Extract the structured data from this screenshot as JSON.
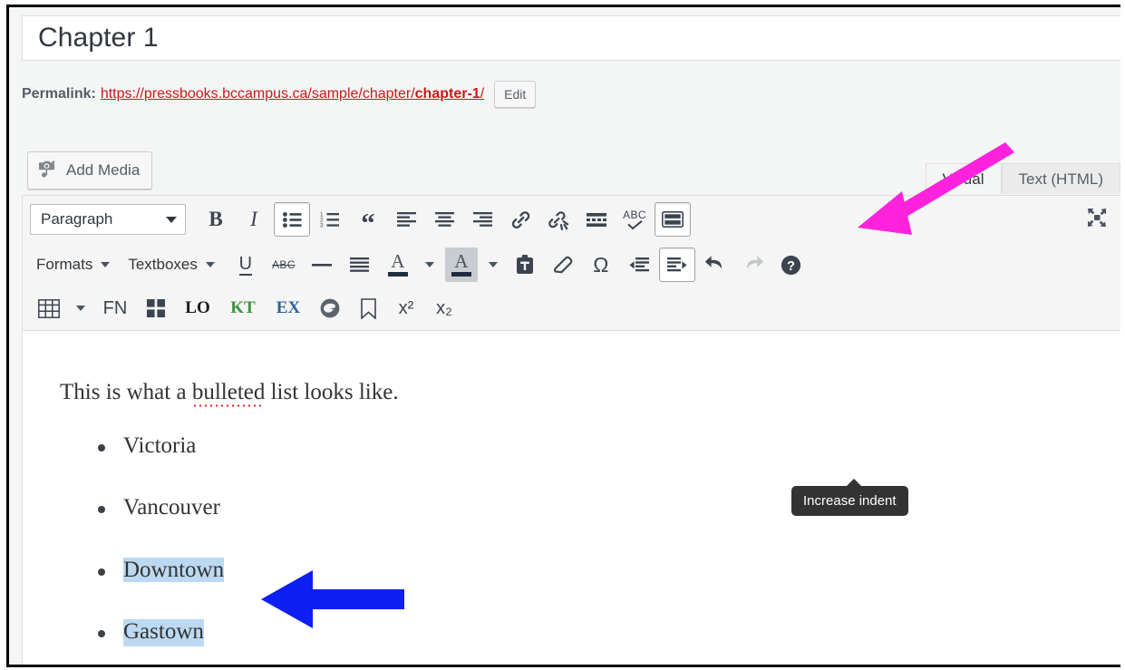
{
  "window": {
    "title_value": "Chapter 1"
  },
  "permalink": {
    "label": "Permalink:",
    "url_prefix": "https://pressbooks.bccampus.ca/sample/chapter/",
    "slug": "chapter-1",
    "url_suffix": "/",
    "edit_label": "Edit"
  },
  "media": {
    "add_media_label": "Add Media",
    "icon": "camera-music-icon"
  },
  "tabs": [
    {
      "label": "Visual",
      "active": true
    },
    {
      "label": "Text (HTML)",
      "active": false
    }
  ],
  "toolbar": {
    "row1": {
      "format_select": "Paragraph",
      "buttons": [
        {
          "name": "bold",
          "label": "B"
        },
        {
          "name": "italic",
          "label": "I"
        },
        {
          "name": "bulleted-list",
          "label": ""
        },
        {
          "name": "numbered-list",
          "label": ""
        },
        {
          "name": "blockquote",
          "label": "“"
        },
        {
          "name": "align-left",
          "label": ""
        },
        {
          "name": "align-center",
          "label": ""
        },
        {
          "name": "align-right",
          "label": ""
        },
        {
          "name": "insert-link",
          "label": ""
        },
        {
          "name": "remove-link",
          "label": ""
        },
        {
          "name": "read-more",
          "label": ""
        },
        {
          "name": "spellcheck",
          "label": "ABC"
        },
        {
          "name": "keyboard-shortcuts",
          "label": ""
        }
      ],
      "fullscreen": "distraction-free-icon"
    },
    "row2": {
      "formats_menu": "Formats",
      "textboxes_menu": "Textboxes",
      "buttons": [
        {
          "name": "underline",
          "label": "U"
        },
        {
          "name": "strikethrough",
          "label": "ABC"
        },
        {
          "name": "horizontal-rule",
          "label": ""
        },
        {
          "name": "justify",
          "label": ""
        },
        {
          "name": "text-color",
          "label": "A"
        },
        {
          "name": "background-color",
          "label": "A"
        },
        {
          "name": "paste-as-text",
          "label": ""
        },
        {
          "name": "clear-formatting",
          "label": ""
        },
        {
          "name": "special-character",
          "label": "Ω"
        },
        {
          "name": "decrease-indent",
          "label": ""
        },
        {
          "name": "increase-indent",
          "label": ""
        },
        {
          "name": "undo",
          "label": ""
        },
        {
          "name": "redo",
          "label": ""
        },
        {
          "name": "help",
          "label": "?"
        }
      ]
    },
    "row3": {
      "buttons": [
        {
          "name": "table",
          "label": ""
        },
        {
          "name": "table-dropdown",
          "label": ""
        },
        {
          "name": "footnote",
          "label": "FN"
        },
        {
          "name": "glossary-grid",
          "label": ""
        },
        {
          "name": "learning-objectives",
          "label": "LO"
        },
        {
          "name": "key-takeaways",
          "label": "KT"
        },
        {
          "name": "exercises",
          "label": "EX"
        },
        {
          "name": "h5p",
          "label": ""
        },
        {
          "name": "anchor",
          "label": ""
        },
        {
          "name": "superscript",
          "label": "x²"
        },
        {
          "name": "subscript",
          "label": "x₂"
        }
      ]
    },
    "tooltip": "Increase indent"
  },
  "content": {
    "paragraph_before": "This is what a ",
    "paragraph_misspelled": "bulleted",
    "paragraph_after": " list looks like.",
    "list_items": [
      {
        "text": "Victoria",
        "selected": false,
        "misspelled": false
      },
      {
        "text": "Vancouver",
        "selected": false,
        "misspelled": false
      },
      {
        "text": "Downtown",
        "selected": true,
        "misspelled": false
      },
      {
        "text": "Gastown",
        "selected": true,
        "misspelled": true
      }
    ]
  },
  "annotations": {
    "magenta_arrow": "points to increase-indent button",
    "blue_arrow": "points to selected list items",
    "magenta_color": "#ff22dd",
    "blue_color": "#0d1ff2"
  },
  "colors": {
    "link": "#cc1818",
    "toolbar_bg": "#f5f5f5",
    "icon": "#4a5260",
    "selection": "#bcd9f2",
    "spellcheck": "#e02020",
    "tooltip_bg": "#333333"
  }
}
